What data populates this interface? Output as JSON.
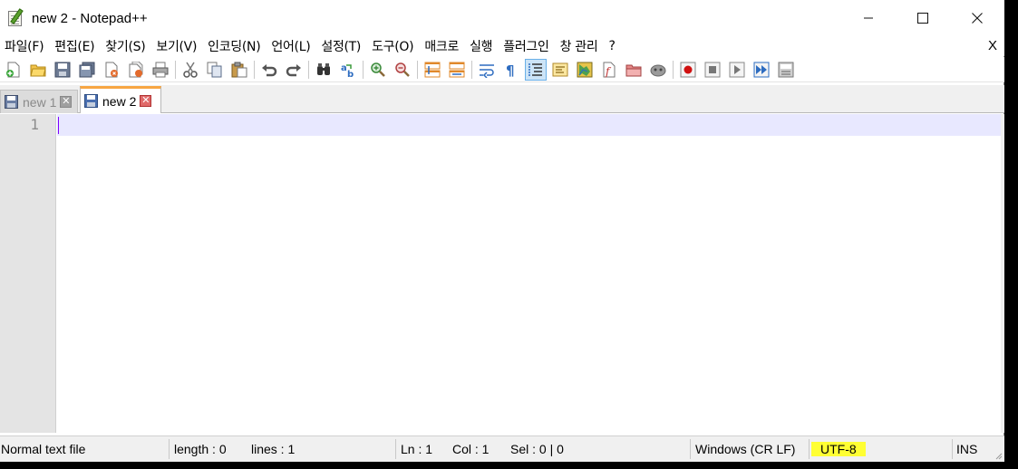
{
  "window": {
    "title": "new 2 - Notepad++",
    "icon": "notepadpp-app-icon",
    "controls": [
      "minimize-icon",
      "maximize-icon",
      "close-icon"
    ]
  },
  "menu": {
    "items": [
      "파일(F)",
      "편집(E)",
      "찾기(S)",
      "보기(V)",
      "인코딩(N)",
      "언어(L)",
      "설정(T)",
      "도구(O)",
      "매크로",
      "실행",
      "플러그인",
      "창 관리",
      "?"
    ],
    "close_label": "X"
  },
  "toolbar": {
    "icons": [
      "new-file-icon",
      "open-file-icon",
      "save-icon",
      "save-all-icon",
      "close-icon",
      "close-all-icon",
      "print-icon",
      "cut-icon",
      "copy-icon",
      "paste-icon",
      "undo-icon",
      "redo-icon",
      "find-icon",
      "replace-icon",
      "zoom-in-icon",
      "zoom-out-icon",
      "sync-vertical-icon",
      "sync-horizontal-icon",
      "word-wrap-icon",
      "show-all-chars-icon",
      "indent-guide-icon",
      "udl-icon",
      "document-map-icon",
      "function-list-icon",
      "folder-workspace-icon",
      "monitoring-icon",
      "record-macro-icon",
      "stop-record-icon",
      "play-macro-icon",
      "run-macro-multiple-icon",
      "save-macro-icon"
    ],
    "active_icon": "indent-guide-icon"
  },
  "tabs": [
    {
      "label": "new 1",
      "active": false
    },
    {
      "label": "new 2",
      "active": true
    }
  ],
  "editor": {
    "line_numbers": [
      "1"
    ],
    "content": ""
  },
  "status": {
    "file_type": "Normal text file",
    "length": "length : 0",
    "lines": "lines : 1",
    "ln": "Ln : 1",
    "col": "Col : 1",
    "sel": "Sel : 0 | 0",
    "eol": "Windows (CR LF)",
    "encoding": "UTF-8",
    "mode": "INS",
    "encoding_highlight_color": "#ffff33"
  }
}
